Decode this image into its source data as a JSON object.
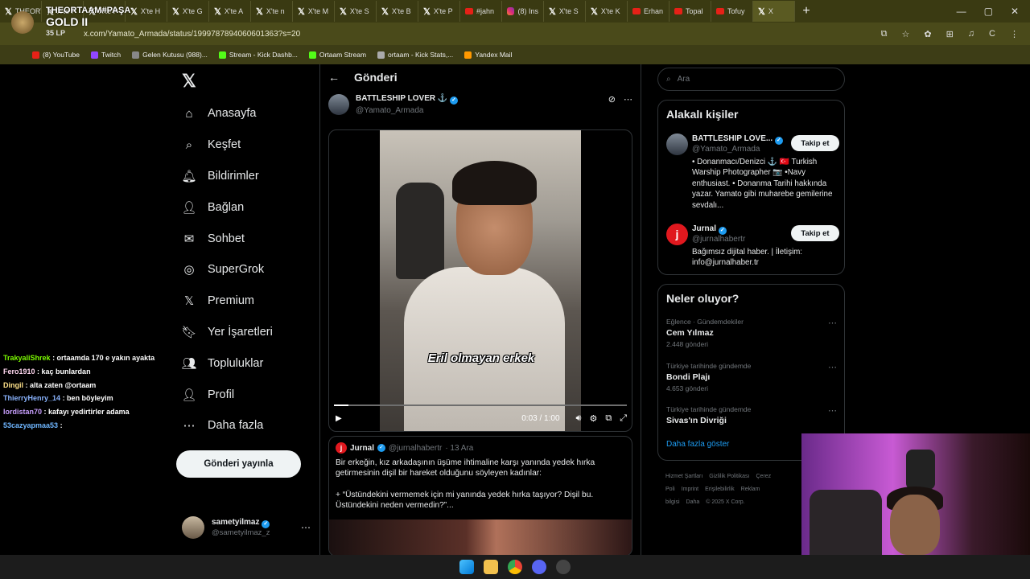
{
  "browser": {
    "tabs": [
      {
        "label": "THEORTAAM#PAŞA X'te B",
        "icon": "x-icon"
      },
      {
        "label": "X'te P",
        "icon": "x-icon"
      },
      {
        "label": "X'te P",
        "icon": "x-icon"
      },
      {
        "label": "X'te H",
        "icon": "x-icon"
      },
      {
        "label": "X'te G",
        "icon": "x-icon"
      },
      {
        "label": "X'te A",
        "icon": "x-icon"
      },
      {
        "label": "X'te n",
        "icon": "x-icon"
      },
      {
        "label": "X'te M",
        "icon": "x-icon"
      },
      {
        "label": "X'te S",
        "icon": "x-icon"
      },
      {
        "label": "X'te B",
        "icon": "x-icon"
      },
      {
        "label": "X'te P",
        "icon": "x-icon"
      },
      {
        "label": "#jahn",
        "icon": "youtube-icon"
      },
      {
        "label": "(8) Ins",
        "icon": "instagram-icon"
      },
      {
        "label": "X'te S",
        "icon": "x-icon"
      },
      {
        "label": "X'te K",
        "icon": "x-icon"
      },
      {
        "label": "Erhan",
        "icon": "youtube-icon"
      },
      {
        "label": "Topal",
        "icon": "youtube-icon"
      },
      {
        "label": "Tofuy",
        "icon": "youtube-icon"
      },
      {
        "label": "X",
        "icon": "x-icon"
      }
    ],
    "url": "x.com/Yamato_Armada/status/1999787894060601363?s=20",
    "bookmarks": [
      {
        "label": "(8) YouTube",
        "color": "#e62117"
      },
      {
        "label": "Twitch",
        "color": "#9146ff"
      },
      {
        "label": "Gelen Kutusu (988)...",
        "color": "#888888"
      },
      {
        "label": "Stream - Kick Dashb...",
        "color": "#53fc18"
      },
      {
        "label": "Ortaam Stream",
        "color": "#53fc18"
      },
      {
        "label": "ortaam - Kick Stats,...",
        "color": "#aaaaaa"
      },
      {
        "label": "Yandex Mail",
        "color": "#ff9900"
      }
    ]
  },
  "overlay": {
    "name": "THEORTAAM#PAŞA",
    "tier": "GOLD II",
    "lp": "35 LP"
  },
  "nav": {
    "items": [
      {
        "label": "Anasayfa",
        "icon": "home-icon",
        "glyph": "⌂"
      },
      {
        "label": "Keşfet",
        "icon": "search-icon",
        "glyph": "⌕"
      },
      {
        "label": "Bildirimler",
        "icon": "bell-icon",
        "glyph": "🔔︎"
      },
      {
        "label": "Bağlan",
        "icon": "add-person-icon",
        "glyph": "👤︎"
      },
      {
        "label": "Sohbet",
        "icon": "mail-icon",
        "glyph": "✉"
      },
      {
        "label": "SuperGrok",
        "icon": "grok-icon",
        "glyph": "◎"
      },
      {
        "label": "Premium",
        "icon": "x-premium-icon",
        "glyph": "𝕏"
      },
      {
        "label": "Yer İşaretleri",
        "icon": "bookmark-icon",
        "glyph": "🔖︎"
      },
      {
        "label": "Topluluklar",
        "icon": "communities-icon",
        "glyph": "👥︎"
      },
      {
        "label": "Profil",
        "icon": "profile-icon",
        "glyph": "👤︎"
      },
      {
        "label": "Daha fazla",
        "icon": "more-circle-icon",
        "glyph": "⋯"
      }
    ],
    "post_button": "Gönderi yayınla"
  },
  "me": {
    "name": "sametyilmaz",
    "handle": "@sametyilmaz_z"
  },
  "post": {
    "header": "Gönderi",
    "author_name": "BATTLESHIP LOVER ⚓",
    "author_handle": "@Yamato_Armada",
    "video": {
      "subtitle": "Eril olmayan erkek",
      "time": "0:03 / 1:00",
      "progress": 0.05
    },
    "quote": {
      "name": "Jurnal",
      "handle": "@jurnalhabertr",
      "date": "· 13 Ara",
      "text1": "Bir erkeğin, kız arkadaşının üşüme ihtimaline karşı yanında yedek hırka getirmesinin dişil bir hareket olduğunu söyleyen kadınlar:",
      "text2": "+ “Üstündekini vermemek için mi yanında yedek hırka taşıyor? Dişil bu. Üstündekini neden vermedin?”..."
    }
  },
  "sidebar": {
    "search_placeholder": "Ara",
    "related_title": "Alakalı kişiler",
    "people": [
      {
        "name": "BATTLESHIP LOVE...",
        "handle": "@Yamato_Armada",
        "bio": "• Donanmacı/Denizci ⚓ 🇹🇷 Turkish Warship Photographer 📷 •Navy enthusiast. • Donanma Tarihi hakkında yazar. Yamato gibi muharebe gemilerine sevdalı...",
        "follow": "Takip et"
      },
      {
        "name": "Jurnal",
        "handle": "@jurnalhabertr",
        "bio": "Bağımsız dijital haber. | İletişim: info@jurnalhaber.tr",
        "follow": "Takip et"
      }
    ],
    "trends_title": "Neler oluyor?",
    "trends": [
      {
        "context": "Eğlence · Gündemdekiler",
        "title": "Cem Yılmaz",
        "count": "2.448 gönderi"
      },
      {
        "context": "Türkiye tarihinde gündemde",
        "title": "Bondi Plajı",
        "count": "4.653 gönderi"
      },
      {
        "context": "Türkiye tarihinde gündemde",
        "title": "Sivas'ın Divriği",
        "count": ""
      }
    ],
    "show_more": "Daha fazla göster",
    "footer": [
      "Hizmet Şartları",
      "Gizlilik Politikası",
      "Çerez Poli",
      "Imprint",
      "Erişilebilirlik",
      "Reklam bilgisi",
      "Daha",
      "© 2025 X Corp."
    ]
  },
  "chat": [
    {
      "user": "TrakyaliShrek",
      "msg": ": ortaamda 170 e yakın ayakta"
    },
    {
      "user": "Fero1910",
      "msg": ": kaç bunlardan"
    },
    {
      "user": "Dingil",
      "msg": ": alta zaten @ortaam"
    },
    {
      "user": "ThierryHenry_14",
      "msg": ": ben böyleyim"
    },
    {
      "user": "lordistan70",
      "msg": ": kafayı yedirtirler adama"
    },
    {
      "user": "53cazyapmaa53",
      "msg": ":"
    }
  ]
}
